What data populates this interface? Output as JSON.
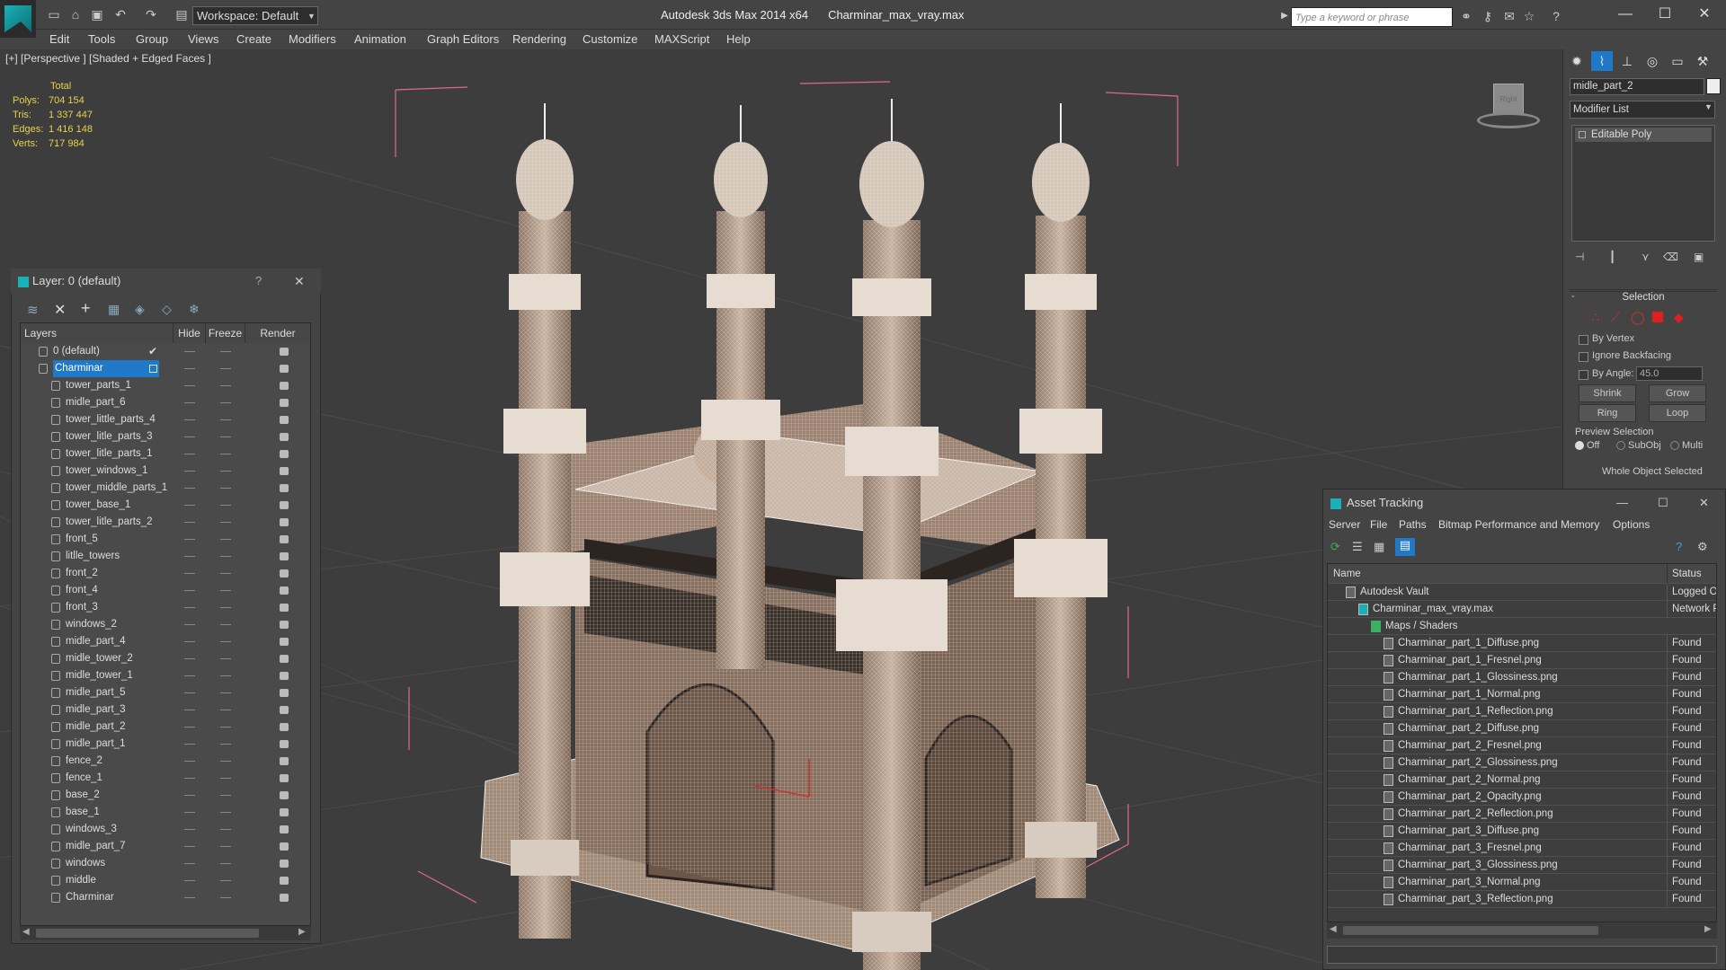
{
  "window": {
    "app_title": "Autodesk 3ds Max  2014 x64",
    "file_title": "Charminar_max_vray.max",
    "workspace_label": "Workspace: Default",
    "search_placeholder": "Type a keyword or phrase"
  },
  "menu": [
    "Edit",
    "Tools",
    "Group",
    "Views",
    "Create",
    "Modifiers",
    "Animation",
    "Graph Editors",
    "Rendering",
    "Customize",
    "MAXScript",
    "Help"
  ],
  "viewport": {
    "label": "[+] [Perspective ] [Shaded + Edged Faces ]",
    "stats": {
      "header": "Total",
      "rows": [
        {
          "k": "Polys:",
          "v": "704 154"
        },
        {
          "k": "Tris:",
          "v": "1 337 447"
        },
        {
          "k": "Edges:",
          "v": "1 416 148"
        },
        {
          "k": "Verts:",
          "v": "717 984"
        }
      ]
    },
    "viewcube_label": "Right"
  },
  "layer_dialog": {
    "title": "Layer: 0 (default)",
    "help": "?",
    "columns": [
      "Layers",
      "Hide",
      "Freeze",
      "Render"
    ],
    "layers": [
      {
        "name": "0 (default)",
        "level": 0,
        "active": true
      },
      {
        "name": "Charminar",
        "level": 0,
        "selected": true
      },
      {
        "name": "tower_parts_1",
        "level": 1
      },
      {
        "name": "midle_part_6",
        "level": 1
      },
      {
        "name": "tower_little_parts_4",
        "level": 1
      },
      {
        "name": "tower_litle_parts_3",
        "level": 1
      },
      {
        "name": "tower_litle_parts_1",
        "level": 1
      },
      {
        "name": "tower_windows_1",
        "level": 1
      },
      {
        "name": "tower_middle_parts_1",
        "level": 1
      },
      {
        "name": "tower_base_1",
        "level": 1
      },
      {
        "name": "tower_litle_parts_2",
        "level": 1
      },
      {
        "name": "front_5",
        "level": 1
      },
      {
        "name": "litlle_towers",
        "level": 1
      },
      {
        "name": "front_2",
        "level": 1
      },
      {
        "name": "front_4",
        "level": 1
      },
      {
        "name": "front_3",
        "level": 1
      },
      {
        "name": "windows_2",
        "level": 1
      },
      {
        "name": "midle_part_4",
        "level": 1
      },
      {
        "name": "midle_tower_2",
        "level": 1
      },
      {
        "name": "midle_tower_1",
        "level": 1
      },
      {
        "name": "midle_part_5",
        "level": 1
      },
      {
        "name": "midle_part_3",
        "level": 1
      },
      {
        "name": "midle_part_2",
        "level": 1
      },
      {
        "name": "midle_part_1",
        "level": 1
      },
      {
        "name": "fence_2",
        "level": 1
      },
      {
        "name": "fence_1",
        "level": 1
      },
      {
        "name": "base_2",
        "level": 1
      },
      {
        "name": "base_1",
        "level": 1
      },
      {
        "name": "windows_3",
        "level": 1
      },
      {
        "name": "midle_part_7",
        "level": 1
      },
      {
        "name": "windows",
        "level": 1
      },
      {
        "name": "middle",
        "level": 1
      },
      {
        "name": "Charminar",
        "level": 1
      }
    ]
  },
  "command_panel": {
    "object_name": "midle_part_2",
    "modifier_list": "Modifier List",
    "stack_item": "Editable Poly",
    "selection": {
      "title": "Selection",
      "by_vertex": "By Vertex",
      "ignore_backfacing": "Ignore Backfacing",
      "by_angle": "By Angle:",
      "angle_value": "45.0",
      "shrink": "Shrink",
      "grow": "Grow",
      "ring": "Ring",
      "loop": "Loop",
      "preview_title": "Preview Selection",
      "opt_off": "Off",
      "opt_subobj": "SubObj",
      "opt_multi": "Multi",
      "status": "Whole Object Selected"
    }
  },
  "asset_tracking": {
    "title": "Asset Tracking",
    "menu": [
      "Server",
      "File",
      "Paths",
      "Bitmap Performance and Memory",
      "Options"
    ],
    "columns": [
      "Name",
      "Status"
    ],
    "rows": [
      {
        "name": "Autodesk Vault",
        "status": "Logged Ou",
        "level": 0
      },
      {
        "name": "Charminar_max_vray.max",
        "status": "Network Pa",
        "level": 1
      },
      {
        "name": "Maps / Shaders",
        "status": "",
        "level": 2
      },
      {
        "name": "Charminar_part_1_Diffuse.png",
        "status": "Found",
        "level": 3
      },
      {
        "name": "Charminar_part_1_Fresnel.png",
        "status": "Found",
        "level": 3
      },
      {
        "name": "Charminar_part_1_Glossiness.png",
        "status": "Found",
        "level": 3
      },
      {
        "name": "Charminar_part_1_Normal.png",
        "status": "Found",
        "level": 3
      },
      {
        "name": "Charminar_part_1_Reflection.png",
        "status": "Found",
        "level": 3
      },
      {
        "name": "Charminar_part_2_Diffuse.png",
        "status": "Found",
        "level": 3
      },
      {
        "name": "Charminar_part_2_Fresnel.png",
        "status": "Found",
        "level": 3
      },
      {
        "name": "Charminar_part_2_Glossiness.png",
        "status": "Found",
        "level": 3
      },
      {
        "name": "Charminar_part_2_Normal.png",
        "status": "Found",
        "level": 3
      },
      {
        "name": "Charminar_part_2_Opacity.png",
        "status": "Found",
        "level": 3
      },
      {
        "name": "Charminar_part_2_Reflection.png",
        "status": "Found",
        "level": 3
      },
      {
        "name": "Charminar_part_3_Diffuse.png",
        "status": "Found",
        "level": 3
      },
      {
        "name": "Charminar_part_3_Fresnel.png",
        "status": "Found",
        "level": 3
      },
      {
        "name": "Charminar_part_3_Glossiness.png",
        "status": "Found",
        "level": 3
      },
      {
        "name": "Charminar_part_3_Normal.png",
        "status": "Found",
        "level": 3
      },
      {
        "name": "Charminar_part_3_Reflection.png",
        "status": "Found",
        "level": 3
      }
    ]
  },
  "colors": {
    "selection_blue": "#1f78c8",
    "stats_yellow": "#e8d24a",
    "bbox_pink": "#e06a8a",
    "model_stone": "#b49a86"
  }
}
